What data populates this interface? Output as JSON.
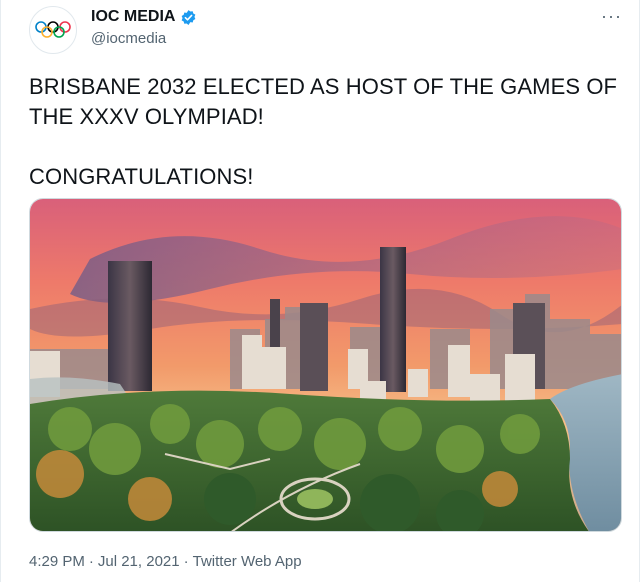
{
  "account": {
    "name": "IOC MEDIA",
    "handle": "@iocmedia",
    "verified": true,
    "verified_color": "#1d9bf0"
  },
  "icons": {
    "avatar": "olympic-rings-icon",
    "verified": "verified-badge-icon",
    "more": "more-options-icon"
  },
  "tweet": {
    "text": "BRISBANE 2032 ELECTED AS HOST OF THE GAMES OF\nTHE XXXV OLYMPIAD!\n\nCONGRATULATIONS!"
  },
  "footer": {
    "time": "4:29 PM",
    "separator1": "·",
    "date": "Jul 21, 2021",
    "separator2": "·",
    "app": "Twitter Web App"
  },
  "more_label": "···",
  "colors": {
    "text": "#0f1419",
    "muted": "#536471"
  }
}
